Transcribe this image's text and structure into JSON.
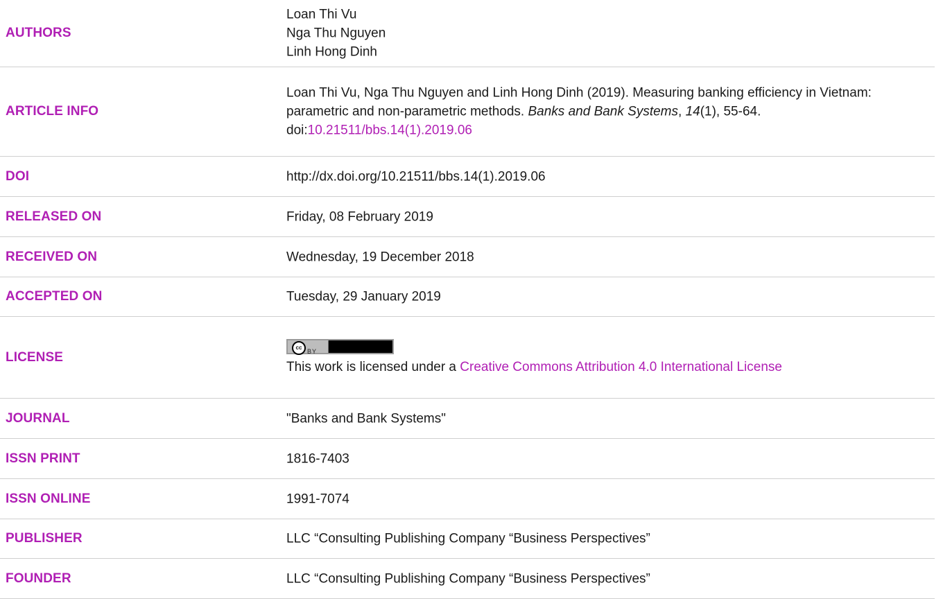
{
  "rows": [
    {
      "label": "AUTHORS",
      "lines": [
        "Loan Thi Vu",
        "Nga Thu Nguyen",
        "Linh Hong Dinh"
      ]
    },
    {
      "label": "ARTICLE INFO",
      "citation_prefix": "Loan Thi Vu, Nga Thu Nguyen and Linh Hong Dinh (2019). Measuring banking efficiency in Vietnam: parametric and non-parametric methods. ",
      "journal_italic": "Banks and Bank Systems",
      "sep": ", ",
      "volume_italic": "14",
      "issue_pages": "(1), 55-64. doi:",
      "doi_link": "10.21511/bbs.14(1).2019.06"
    },
    {
      "label": "DOI",
      "value": "http://dx.doi.org/10.21511/bbs.14(1).2019.06"
    },
    {
      "label": "RELEASED ON",
      "value": "Friday, 08 February 2019"
    },
    {
      "label": "RECEIVED ON",
      "value": "Wednesday, 19 December 2018"
    },
    {
      "label": "ACCEPTED ON",
      "value": "Tuesday, 29 January 2019"
    },
    {
      "label": "LICENSE",
      "badge_cc": "cc",
      "badge_by": "BY",
      "text_prefix": "This work is licensed under a ",
      "license_link": "Creative Commons Attribution 4.0 International License"
    },
    {
      "label": "JOURNAL",
      "value": "\"Banks and Bank Systems\""
    },
    {
      "label": "ISSN PRINT",
      "value": "1816-7403"
    },
    {
      "label": "ISSN ONLINE",
      "value": "1991-7074"
    },
    {
      "label": "PUBLISHER",
      "value": "LLC “Consulting Publishing Company “Business Perspectives”"
    },
    {
      "label": "FOUNDER",
      "value": "LLC “Consulting Publishing Company “Business Perspectives”"
    }
  ],
  "colors": {
    "label": "#b01fb4",
    "link": "#b01fb4",
    "text": "#1a1a1a",
    "rule": "#cfcfcf"
  }
}
